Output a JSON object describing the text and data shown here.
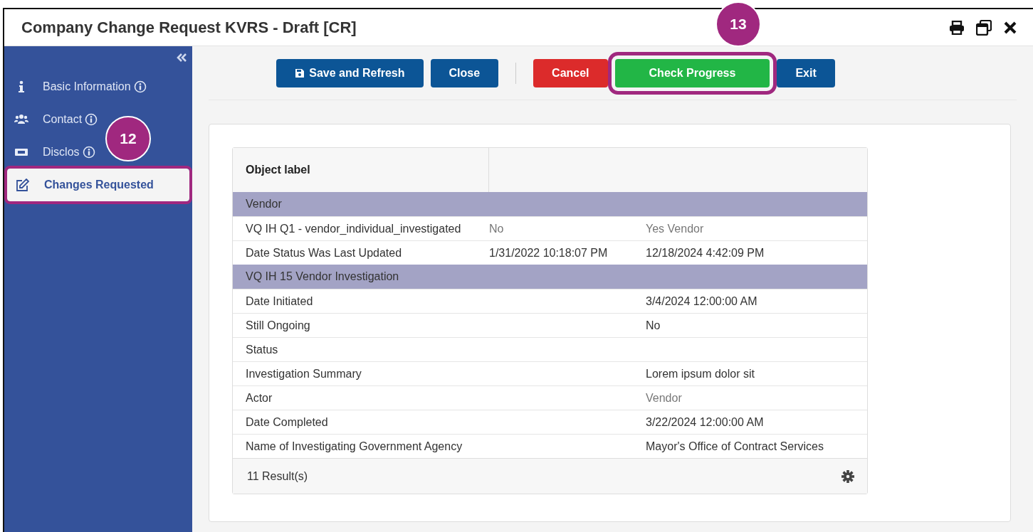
{
  "window": {
    "title": "Company Change Request KVRS - Draft [CR]"
  },
  "sidebar": {
    "items": [
      {
        "label": "Basic Information",
        "info": true,
        "selected": false
      },
      {
        "label": "Contact",
        "info": true,
        "selected": false
      },
      {
        "label": "Disclos",
        "info": true,
        "selected": false
      },
      {
        "label": "Changes Requested",
        "info": false,
        "selected": true
      }
    ]
  },
  "toolbar": {
    "buttons": [
      {
        "label": "Save and Refresh",
        "kind": "primary",
        "highlighted": false
      },
      {
        "label": "Close",
        "kind": "primary",
        "highlighted": false
      },
      {
        "kind": "divider"
      },
      {
        "label": "Cancel",
        "kind": "danger",
        "highlighted": false
      },
      {
        "label": "Check Progress",
        "kind": "success",
        "highlighted": true
      },
      {
        "label": "Exit",
        "kind": "primary",
        "highlighted": false
      }
    ]
  },
  "callouts": [
    {
      "number": "12"
    },
    {
      "number": "13"
    }
  ],
  "table": {
    "columns": [
      "Object label"
    ],
    "rows": [
      {
        "kind": "group",
        "label": "Vendor"
      },
      {
        "kind": "field",
        "label": "VQ IH Q1 - vendor_individual_investigated",
        "old": {
          "text": "No",
          "muted": true
        },
        "new": {
          "text": "Yes Vendor",
          "muted": true
        }
      },
      {
        "kind": "field",
        "label": "Date Status Was Last Updated",
        "old": {
          "text": "1/31/2022 10:18:07 PM",
          "muted": false
        },
        "new": {
          "text": "12/18/2024 4:42:09 PM",
          "muted": false
        }
      },
      {
        "kind": "group",
        "label": "VQ IH 15 Vendor Investigation"
      },
      {
        "kind": "field",
        "label": "Date Initiated",
        "new": {
          "text": "3/4/2024 12:00:00 AM",
          "muted": false
        }
      },
      {
        "kind": "field",
        "label": "Still Ongoing",
        "new": {
          "text": "No",
          "muted": false
        }
      },
      {
        "kind": "field",
        "label": "Status"
      },
      {
        "kind": "field",
        "label": "Investigation Summary",
        "new": {
          "text": "Lorem ipsum dolor sit",
          "muted": false
        }
      },
      {
        "kind": "field",
        "label": "Actor",
        "new": {
          "text": "Vendor",
          "muted": true
        }
      },
      {
        "kind": "field",
        "label": "Date Completed",
        "new": {
          "text": "3/22/2024 12:00:00 AM",
          "muted": false
        }
      },
      {
        "kind": "field",
        "label": "Name of Investigating Government Agency",
        "new": {
          "text": "Mayor's Office of Contract Services",
          "muted": false
        }
      }
    ],
    "footer": "11 Result(s)"
  }
}
